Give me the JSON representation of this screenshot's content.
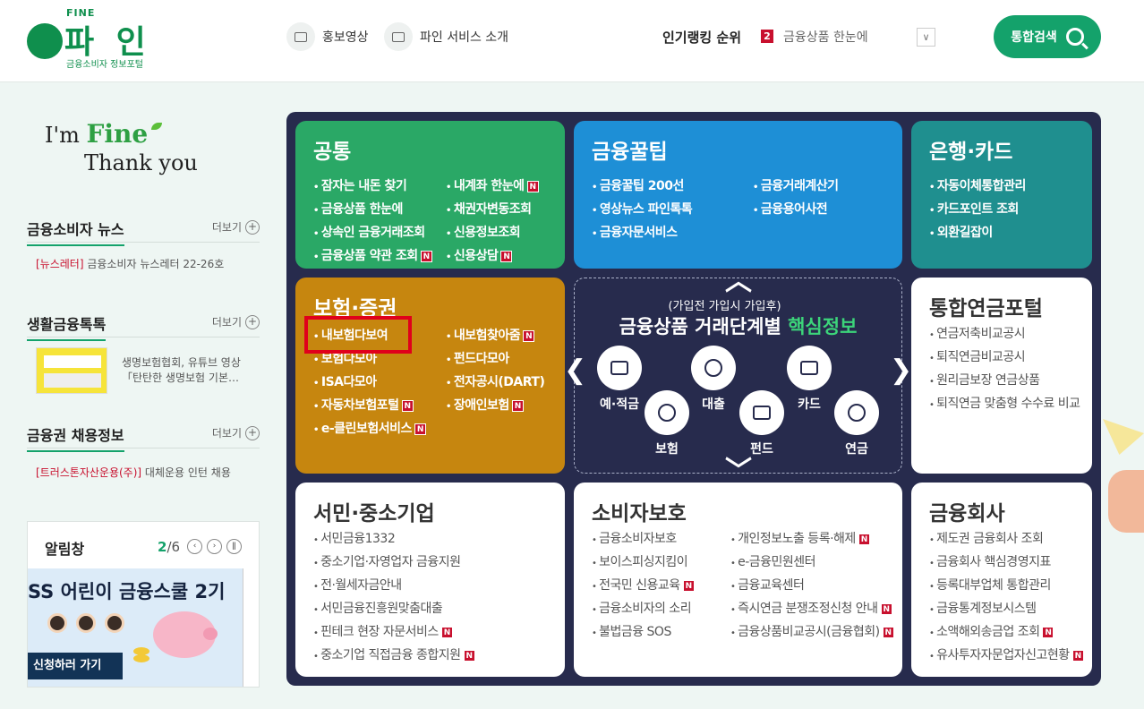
{
  "header": {
    "logo_tag": "FINE",
    "logo_main": "파 인",
    "logo_sub": "금융소비자 정보포털",
    "promo_video": "홍보영상",
    "service_intro": "파인 서비스 소개",
    "ranking_title": "인기랭킹 순위",
    "ranking_num": "2",
    "ranking_item": "금융상품 한눈에",
    "search_label": "통합검색"
  },
  "left": {
    "im": "I'm",
    "fine": "Fine",
    "thanks": "Thank you",
    "more_label": "더보기",
    "news": {
      "title": "금융소비자 뉴스",
      "tag": "[뉴스레터]",
      "text": " 금융소비자 뉴스레터 22-26호"
    },
    "life": {
      "title": "생활금융톡톡",
      "line1": "생명보험협회, 유튜브 영상",
      "line2": "「탄탄한 생명보험 기본…"
    },
    "jobs": {
      "title": "금융권 채용정보",
      "tag": "[트러스톤자산운용(주)]",
      "text": " 대체운용 인턴 채용"
    },
    "notice": {
      "title": "알림창",
      "current": "2",
      "total": "/6",
      "banner_text": "SS 어린이 금융스쿨 2기",
      "banner_button": "신청하러 가기"
    }
  },
  "cards": {
    "common": {
      "title": "공통",
      "col1": [
        "잠자는 내돈 찾기",
        "금융상품 한눈에",
        "상속인 금융거래조회",
        "금융상품 약관 조회"
      ],
      "col2": [
        "내계좌 한눈에",
        "채권자변동조회",
        "신용정보조회",
        "신용상담"
      ]
    },
    "tip": {
      "title": "금융꿀팁",
      "col1": [
        "금융꿀팁 200선",
        "영상뉴스 파인톡톡",
        "금융자문서비스"
      ],
      "col2": [
        "금융거래계산기",
        "금융용어사전"
      ]
    },
    "bank": {
      "title": "은행·카드",
      "items": [
        "자동이체통합관리",
        "카드포인트 조회",
        "외환길잡이"
      ]
    },
    "insurance": {
      "title": "보험·증권",
      "col1": [
        "내보험다보여",
        "보험다모아",
        "ISA다모아",
        "자동차보험포털",
        "e-클린보험서비스"
      ],
      "col2": [
        "내보험찾아줌",
        "펀드다모아",
        "전자공시(DART)",
        "장애인보험"
      ]
    },
    "pension": {
      "title": "통합연금포털",
      "items": [
        "연금저축비교공시",
        "퇴직연금비교공시",
        "원리금보장 연금상품",
        "퇴직연금 맞춤형 수수료 비교"
      ]
    },
    "sme": {
      "title": "서민·중소기업",
      "items": [
        "서민금융1332",
        "중소기업·자영업자 금융지원",
        "전·월세자금안내",
        "서민금융진흥원맞춤대출",
        "핀테크 현장 자문서비스",
        "중소기업 직접금융 종합지원"
      ]
    },
    "consumer": {
      "title": "소비자보호",
      "col1": [
        "금융소비자보호",
        "보이스피싱지킴이",
        "전국민 신용교육",
        "금융소비자의 소리",
        "불법금융 SOS"
      ],
      "col2": [
        "개인정보노출 등록·해제",
        "e-금융민원센터",
        "금융교육센터",
        "즉시연금 분쟁조정신청 안내",
        "금융상품비교공시(금융협회)"
      ]
    },
    "fincomp": {
      "title": "금융회사",
      "items": [
        "제도권 금융회사 조회",
        "금융회사 핵심경영지표",
        "등록대부업체 통합관리",
        "금융통계정보시스템",
        "소액해외송금업 조회",
        "유사투자자문업자신고현황"
      ]
    }
  },
  "center": {
    "subtitle": "(가입전 가입시 가입후)",
    "title": "금융상품 거래단계별",
    "title_hl": "핵심정보",
    "stages": [
      "예·적금",
      "대출",
      "카드",
      "보험",
      "펀드",
      "연금"
    ]
  },
  "new_badge": "N",
  "colors": {
    "brand_green": "#14a26b",
    "common": "#2aa866",
    "tip": "#1e8fd6",
    "bank": "#1f8f8f",
    "insurance": "#c6860f",
    "board": "#272b4d",
    "highlight": "#e0001b"
  }
}
